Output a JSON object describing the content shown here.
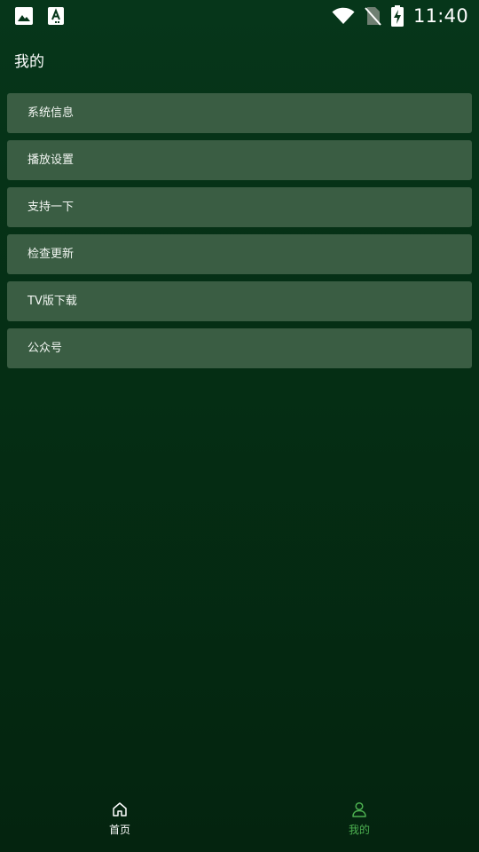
{
  "status_bar": {
    "time": "11:40",
    "left_icons": [
      "image-icon",
      "font-a-icon"
    ],
    "right_icons": [
      "wifi-icon",
      "no-sim-icon",
      "battery-charging-icon"
    ]
  },
  "page": {
    "title": "我的"
  },
  "menu": {
    "items": [
      {
        "label": "系统信息"
      },
      {
        "label": "播放设置"
      },
      {
        "label": "支持一下"
      },
      {
        "label": "检查更新"
      },
      {
        "label": "TV版下载"
      },
      {
        "label": "公众号"
      }
    ]
  },
  "bottom_nav": {
    "home": {
      "label": "首页",
      "icon": "home-icon"
    },
    "mine": {
      "label": "我的",
      "icon": "user-icon",
      "active": true
    }
  },
  "colors": {
    "background": "#05301a",
    "menu_item_bg": "#3a5d43",
    "active_accent": "#4caf50",
    "text": "#ffffff"
  }
}
